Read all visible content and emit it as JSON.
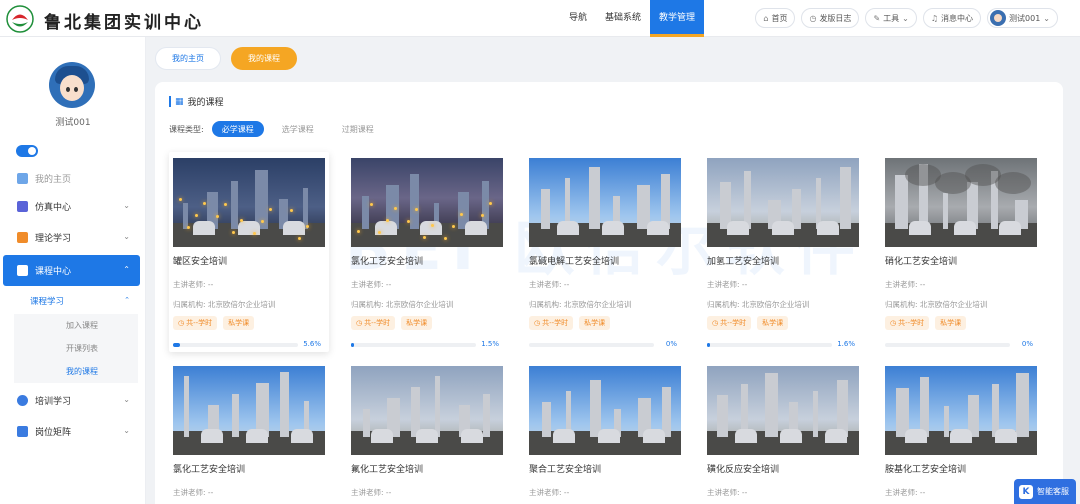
{
  "header": {
    "brand": "鲁北集团实训中心",
    "nav": [
      "导航",
      "基础系统",
      "教学管理"
    ],
    "active_nav": 2,
    "home": "首页",
    "changelog": "发版日志",
    "tools": "工具",
    "messages": "消息中心",
    "user": "测试001"
  },
  "sidebar": {
    "username": "测试001",
    "home": "我的主页",
    "items": [
      {
        "label": "仿真中心",
        "icon_color": "#5a63d8"
      },
      {
        "label": "理论学习",
        "icon_color": "#f08c2a"
      },
      {
        "label": "课程中心",
        "icon_color": "#ffffff"
      }
    ],
    "sub": "课程学习",
    "subsub": [
      "加入课程",
      "开课列表",
      "我的课程"
    ],
    "items2": [
      {
        "label": "培训学习",
        "icon_color": "#3a7be0"
      },
      {
        "label": "岗位矩阵",
        "icon_color": "#3a7be0"
      }
    ]
  },
  "tabs": [
    "我的主页",
    "我的课程"
  ],
  "panel": {
    "title": "我的课程",
    "filter_label": "课程类型:",
    "filters": [
      "必学课程",
      "选学课程",
      "过期课程"
    ],
    "watermark": "BEI 欧倍尔软件"
  },
  "course_labels": {
    "teacher": "主讲老师: --",
    "org": "归属机构: 北京欧倍尔企业培训",
    "hours": "共--学时",
    "type": "私学课"
  },
  "courses_row1": [
    {
      "name": "罐区安全培训",
      "progress": "5.6%",
      "p": 0.056
    },
    {
      "name": "氯化工艺安全培训",
      "progress": "1.5%",
      "p": 0.015
    },
    {
      "name": "氯碱电解工艺安全培训",
      "progress": "0%",
      "p": 0
    },
    {
      "name": "加氢工艺安全培训",
      "progress": "1.6%",
      "p": 0.016
    },
    {
      "name": "硝化工艺安全培训",
      "progress": "0%",
      "p": 0
    }
  ],
  "courses_row2": [
    {
      "name": "氯化工艺安全培训"
    },
    {
      "name": "氟化工艺安全培训"
    },
    {
      "name": "聚合工艺安全培训"
    },
    {
      "name": "磺化反应安全培训"
    },
    {
      "name": "胺基化工艺安全培训"
    }
  ],
  "helper": {
    "label": "智能客服",
    "glyph": "K"
  }
}
